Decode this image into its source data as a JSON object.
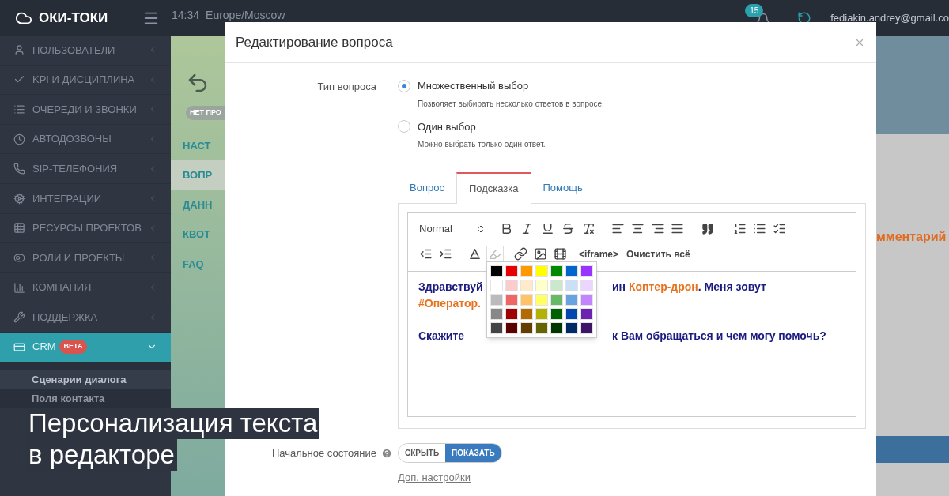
{
  "topbar": {
    "logo": "ОКИ-ТОКИ",
    "time": "14:34",
    "timezone": "Europe/Moscow",
    "notifications": "15",
    "user": "fediakin.andrey@gmail.co"
  },
  "sidebar": {
    "items": [
      {
        "label": "ПОЛЬЗОВАТЕЛИ",
        "selected": false,
        "expanded": false
      },
      {
        "label": "KPI И ДИСЦИПЛИНА",
        "selected": false,
        "expanded": false
      },
      {
        "label": "ОЧЕРЕДИ И ЗВОНКИ",
        "selected": false,
        "expanded": false
      },
      {
        "label": "АВТОДОЗВОНЫ",
        "selected": false,
        "expanded": false
      },
      {
        "label": "SIP-ТЕЛЕФОНИЯ",
        "selected": false,
        "expanded": false
      },
      {
        "label": "ИНТЕГРАЦИИ",
        "selected": false,
        "expanded": false
      },
      {
        "label": "РЕСУРСЫ ПРОЕКТОВ",
        "selected": false,
        "expanded": false
      },
      {
        "label": "РОЛИ И ПРОЕКТЫ",
        "selected": false,
        "expanded": false
      },
      {
        "label": "КОМПАНИЯ",
        "selected": false,
        "expanded": false
      },
      {
        "label": "ПОДДЕРЖКА",
        "selected": false,
        "expanded": false
      },
      {
        "label": "CRM",
        "badge": "BETA",
        "selected": true,
        "expanded": true,
        "children": [
          {
            "label": "Сценарии диалога",
            "selected": true
          },
          {
            "label": "Поля контакта",
            "selected": false
          }
        ]
      }
    ]
  },
  "subnav": {
    "badge": "НЕТ ПРО",
    "items": [
      {
        "label": "НАСТ",
        "selected": false
      },
      {
        "label": "ВОПР",
        "selected": true
      },
      {
        "label": "ДАНН",
        "selected": false
      },
      {
        "label": "КВОТ",
        "selected": false
      },
      {
        "label": "FAQ",
        "selected": false
      }
    ]
  },
  "right_panel": {
    "text": "мментарий"
  },
  "modal": {
    "title": "Редактирование вопроса",
    "question_type": {
      "label": "Тип вопроса",
      "options": [
        {
          "label": "Множественный выбор",
          "description": "Позволяет выбирать несколько ответов в вопросе.",
          "selected": true
        },
        {
          "label": "Один выбор",
          "description": "Можно выбрать только один ответ.",
          "selected": false
        }
      ]
    },
    "tabs": [
      {
        "label": "Вопрос",
        "selected": false
      },
      {
        "label": "Подсказка",
        "selected": true
      },
      {
        "label": "Помощь",
        "selected": false
      }
    ],
    "editor": {
      "format": "Normal",
      "iframe": "<iframe>",
      "clear": "Очистить всё",
      "palette": [
        {
          "color": "#000000"
        },
        {
          "color": "#e60000"
        },
        {
          "color": "#ff9900"
        },
        {
          "color": "#ffff00"
        },
        {
          "color": "#008a00"
        },
        {
          "color": "#0066cc"
        },
        {
          "color": "#9933ff"
        },
        {
          "color": "#ffffff"
        },
        {
          "color": "#facccc"
        },
        {
          "color": "#ffebcc"
        },
        {
          "color": "#ffffcc"
        },
        {
          "color": "#cce8cc"
        },
        {
          "color": "#cce0f5"
        },
        {
          "color": "#ebd6ff"
        },
        {
          "color": "#bbbbbb"
        },
        {
          "color": "#f06666"
        },
        {
          "color": "#ffc266"
        },
        {
          "color": "#ffff66"
        },
        {
          "color": "#66b966"
        },
        {
          "color": "#66a3e0"
        },
        {
          "color": "#c285ff"
        },
        {
          "color": "#888888"
        },
        {
          "color": "#a10000"
        },
        {
          "color": "#b26b00"
        },
        {
          "color": "#b2b200"
        },
        {
          "color": "#006100"
        },
        {
          "color": "#0047b2"
        },
        {
          "color": "#6b24b2"
        },
        {
          "color": "#444444"
        },
        {
          "color": "#5c0000"
        },
        {
          "color": "#663d00"
        },
        {
          "color": "#666600"
        },
        {
          "color": "#003700"
        },
        {
          "color": "#002966"
        },
        {
          "color": "#3d1466"
        }
      ],
      "paragraphs": [
        {
          "lines": [
            {
              "left": [
                {
                  "text": "Здравствуй",
                  "color": "#1c1c80"
                }
              ],
              "right": [
                {
                  "text": "ин ",
                  "color": "#1c1c80"
                },
                {
                  "text": "Коптер-дрон",
                  "color": "#e8731f"
                },
                {
                  "text": ". Меня зовут",
                  "color": "#1c1c80"
                }
              ]
            },
            {
              "left": [
                {
                  "text": "#Оператор.",
                  "color": "#e8731f"
                }
              ]
            }
          ]
        },
        {
          "lines": [
            {
              "left": [
                {
                  "text": "Скажите",
                  "color": "#1c1c80"
                }
              ],
              "right": [
                {
                  "text": "к Вам обращаться и чем могу помочь?",
                  "color": "#1c1c80"
                }
              ]
            }
          ]
        }
      ]
    },
    "initial_state": {
      "label": "Начальное состояние",
      "options": [
        {
          "label": "СКРЫТЬ",
          "selected": false
        },
        {
          "label": "ПОКАЗАТЬ",
          "selected": true
        }
      ]
    },
    "more_link": "Доп. настройки"
  },
  "caption": [
    "Персонализация текста",
    "в редакторе"
  ]
}
